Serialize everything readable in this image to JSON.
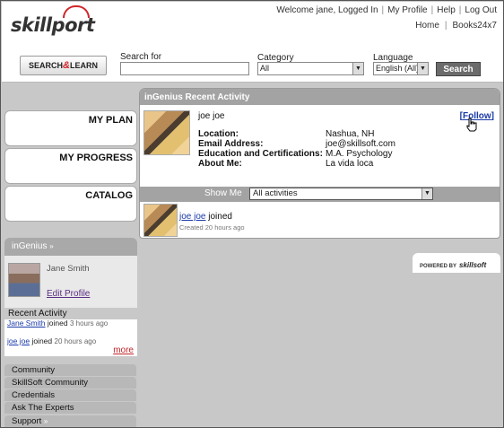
{
  "header": {
    "logo": "skillport",
    "welcome": "Welcome jane, Logged In",
    "links": [
      "My Profile",
      "Help",
      "Log Out"
    ],
    "links2": [
      "Home",
      "Books24x7"
    ]
  },
  "search": {
    "search_learn_label_a": "SEARCH",
    "search_learn_label_b": "LEARN",
    "search_for_label": "Search for",
    "search_for_value": "",
    "category_label": "Category",
    "category_value": "All",
    "language_label": "Language",
    "language_value": "English (All)",
    "button": "Search"
  },
  "nav": {
    "items": [
      "MY PLAN",
      "MY PROGRESS",
      "CATALOG"
    ]
  },
  "ingenius": {
    "title": "inGenius",
    "user_name": "Jane  Smith",
    "edit_profile": "Edit Profile",
    "recent_title": "Recent Activity",
    "recent": [
      {
        "name": "Jane  Smith",
        "action": "joined",
        "time": "3 hours ago"
      },
      {
        "name": "joe  joe",
        "action": "joined",
        "time": "20 hours ago"
      }
    ],
    "more": "more"
  },
  "leftnav": [
    "Community",
    "SkillSoft Community",
    "Credentials",
    "Ask The Experts",
    "Support"
  ],
  "panel": {
    "title": "inGenius Recent Activity",
    "user": "joe  joe",
    "follow": "Follow",
    "fields": [
      {
        "label": "Location:",
        "value": "Nashua, NH"
      },
      {
        "label": "Email Address:",
        "value": "joe@skillsoft.com"
      },
      {
        "label": "Education and Certifications:",
        "value": "M.A. Psychology"
      },
      {
        "label": "About Me:",
        "value": "La vida loca"
      }
    ],
    "show_me_label": "Show Me",
    "show_me_value": "All activities",
    "activity": {
      "name": "joe  joe",
      "action": "joined",
      "time": "Created 20 hours ago"
    }
  },
  "powered_by": {
    "label": "POWERED BY",
    "brand": "skillsoft"
  }
}
